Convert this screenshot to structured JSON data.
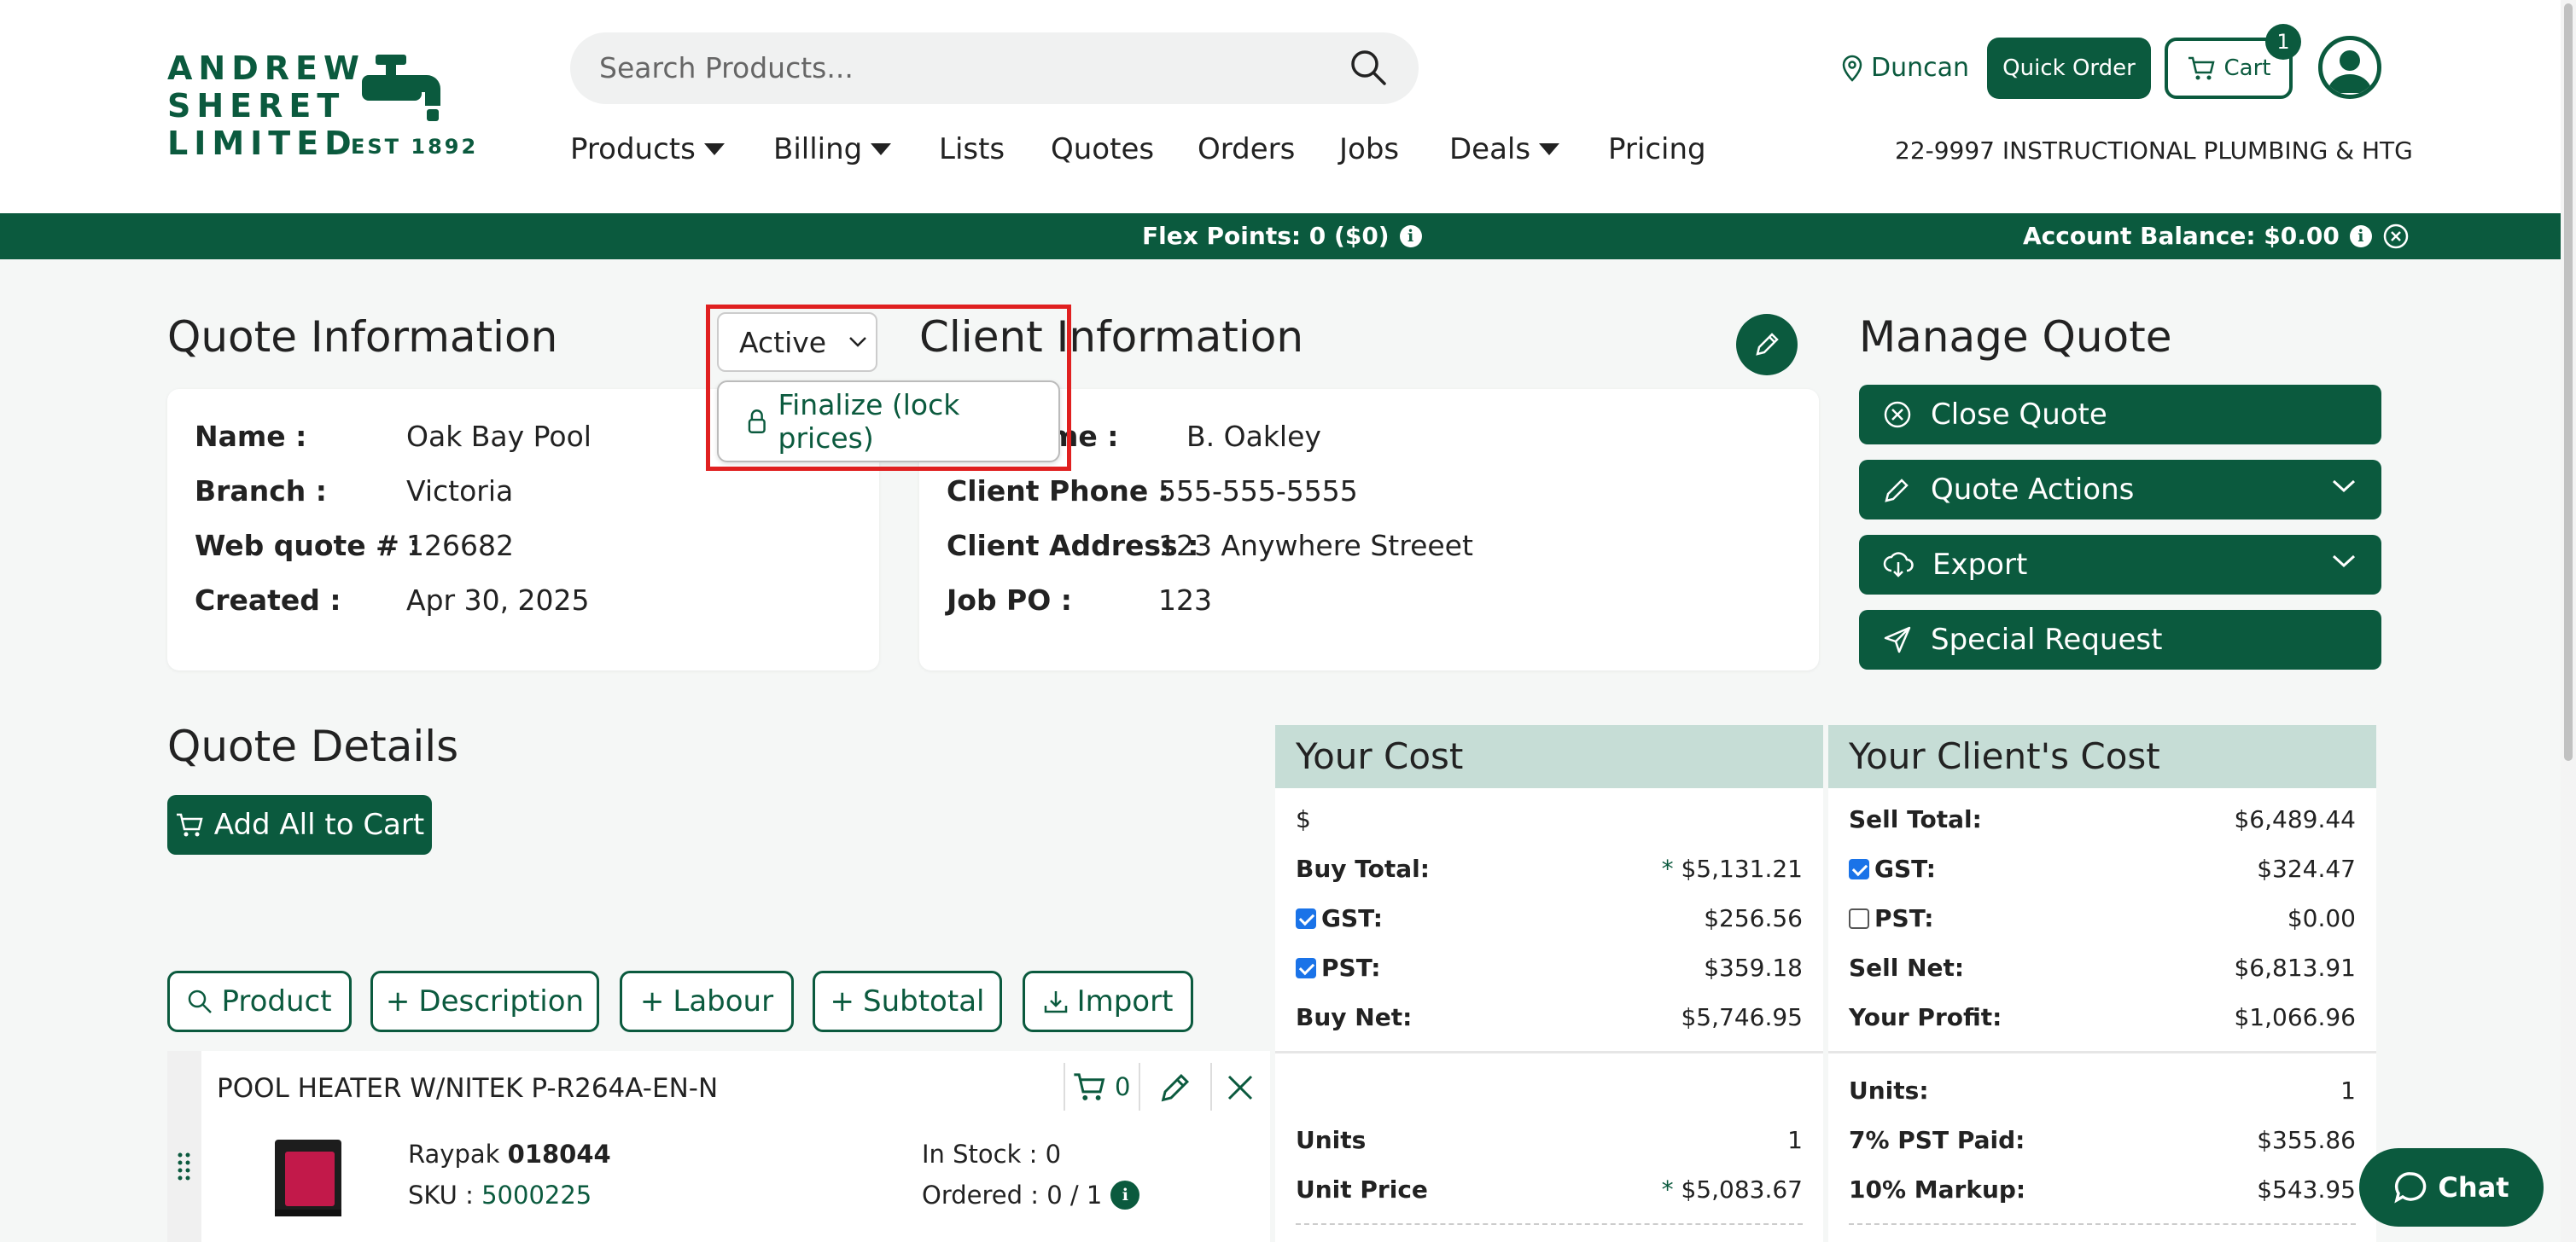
{
  "brand": {
    "line1": "ANDREW",
    "line2": "SHERET",
    "line3": "LIMITED",
    "est": "EST 1892"
  },
  "search": {
    "placeholder": "Search Products..."
  },
  "nav": {
    "products": "Products",
    "billing": "Billing",
    "lists": "Lists",
    "quotes": "Quotes",
    "orders": "Orders",
    "jobs": "Jobs",
    "deals": "Deals",
    "pricing": "Pricing"
  },
  "header": {
    "location": "Duncan",
    "quick_order": "Quick Order",
    "cart_label": "Cart",
    "cart_count": "1",
    "account_name": "22-9997 INSTRUCTIONAL PLUMBING & HTG"
  },
  "banner": {
    "flex_points": "Flex Points: 0 ($0)",
    "account_balance": "Account Balance: $0.00"
  },
  "quote_info": {
    "title": "Quote Information",
    "status": "Active",
    "status_menu_item": "Finalize (lock prices)",
    "name_label": "Name :",
    "name": "Oak Bay Pool",
    "branch_label": "Branch :",
    "branch": "Victoria",
    "web_quote_label": "Web quote # :",
    "web_quote": "126682",
    "created_label": "Created :",
    "created": "Apr 30, 2025"
  },
  "client_info": {
    "title": "Client Information",
    "name_label": "me :",
    "name": "B. Oakley",
    "phone_label": "Client Phone :",
    "phone": "555-555-5555",
    "address_label": "Client Address :",
    "address": "123 Anywhere Streeet",
    "po_label": "Job PO :",
    "po": "123"
  },
  "manage": {
    "title": "Manage Quote",
    "close": "Close Quote",
    "actions": "Quote Actions",
    "export": "Export",
    "special": "Special Request"
  },
  "details": {
    "title": "Quote Details",
    "add_all": "Add All to Cart",
    "btn_product": "Product",
    "btn_description": "Description",
    "btn_labour": "Labour",
    "btn_subtotal": "Subtotal",
    "btn_import": "Import"
  },
  "your_cost": {
    "title": "Your Cost",
    "currency": "$",
    "buy_total_label": "Buy Total:",
    "buy_total": "$5,131.21",
    "gst_label": "GST:",
    "gst": "$256.56",
    "pst_label": "PST:",
    "pst": "$359.18",
    "buy_net_label": "Buy Net:",
    "buy_net": "$5,746.95",
    "units_label": "Units",
    "units": "1",
    "unit_price_label": "Unit Price",
    "unit_price": "$5,083.67"
  },
  "client_cost": {
    "title": "Your Client's Cost",
    "sell_total_label": "Sell Total:",
    "sell_total": "$6,489.44",
    "gst_label": "GST:",
    "gst": "$324.47",
    "pst_label": "PST:",
    "pst": "$0.00",
    "sell_net_label": "Sell Net:",
    "sell_net": "$6,813.91",
    "profit_label": "Your Profit:",
    "profit": "$1,066.96",
    "units_label": "Units:",
    "units": "1",
    "pst_paid_label": "7% PST Paid:",
    "pst_paid": "$355.86",
    "markup_label": "10% Markup:",
    "markup": "$543.95"
  },
  "product": {
    "title": "POOL HEATER W/NITEK P-R264A-EN-N",
    "cart_qty": "0",
    "brand": "Raypak",
    "part": "018044",
    "sku_label": "SKU :",
    "sku": "5000225",
    "stock": "In Stock : 0",
    "ordered": "Ordered : 0 / 1"
  },
  "chat": {
    "label": "Chat"
  },
  "colors": {
    "brand_green": "#0b5a3e",
    "panel_header": "#c6ddd6",
    "highlight": "#e02020"
  }
}
